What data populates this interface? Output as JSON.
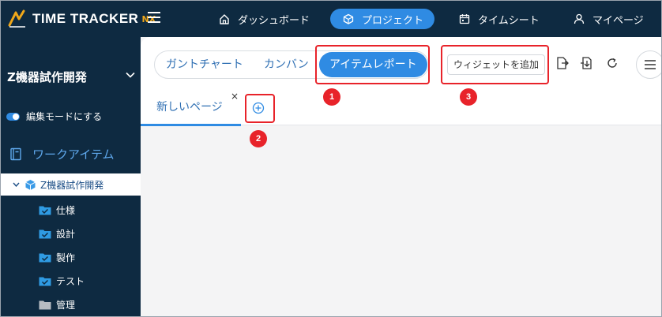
{
  "app": {
    "logo_text": "TIME TRACKER",
    "logo_suffix": "NX"
  },
  "nav": {
    "items": [
      {
        "label": "ダッシュボード",
        "icon": "home-icon"
      },
      {
        "label": "プロジェクト",
        "icon": "cube-icon",
        "active": true
      },
      {
        "label": "タイムシート",
        "icon": "calendar-icon"
      },
      {
        "label": "マイページ",
        "icon": "user-icon"
      }
    ]
  },
  "sidebar": {
    "project_name": "Z機器試作開発",
    "edit_mode_label": "編集モードにする",
    "workitem_label": "ワークアイテム",
    "tree_root": "Z機器試作開発",
    "folders": [
      {
        "label": "仕様",
        "color": "#2f9be3"
      },
      {
        "label": "設計",
        "color": "#2f9be3"
      },
      {
        "label": "製作",
        "color": "#2f9be3"
      },
      {
        "label": "テスト",
        "color": "#2f9be3"
      },
      {
        "label": "管理",
        "color": "#b7bcc2"
      }
    ]
  },
  "main": {
    "view_tabs": [
      {
        "label": "ガントチャート"
      },
      {
        "label": "カンバン"
      },
      {
        "label": "アイテムレポート",
        "active": true
      }
    ],
    "widget_button_label": "ウィジェットを追加",
    "page_tab_label": "新しいページ",
    "page_close_glyph": "×"
  },
  "callouts": [
    "1",
    "2",
    "3"
  ],
  "colors": {
    "dark_navy": "#0e2a41",
    "accent_blue": "#2f8be3",
    "highlight_red": "#e8232a",
    "logo_orange": "#f0a81a"
  }
}
